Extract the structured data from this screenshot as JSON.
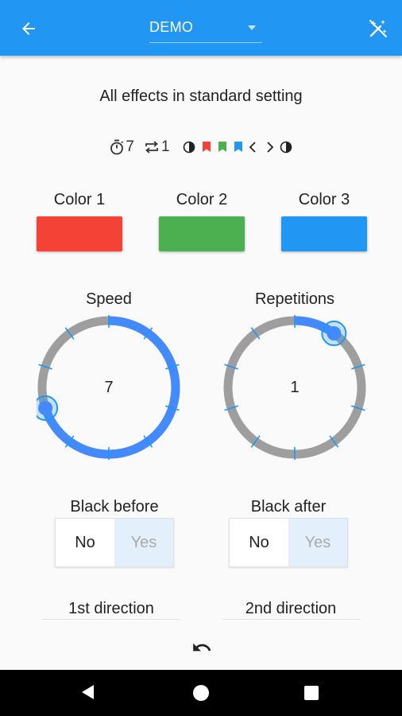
{
  "appbar": {
    "selected_effect": "DEMO",
    "background": "#2196f3"
  },
  "description": "All effects in standard setting",
  "summary": {
    "speed": "7",
    "repetitions": "1",
    "icons": [
      "timer-icon",
      "repeat-icon",
      "half-circle-icon",
      "flag-icon",
      "flag-icon",
      "flag-icon",
      "chevron-left-icon",
      "chevron-right-icon",
      "half-circle-icon"
    ],
    "flag_colors": [
      "#f44336",
      "#4caf50",
      "#2196f3"
    ]
  },
  "colors": [
    {
      "label": "Color 1",
      "value": "#f44336"
    },
    {
      "label": "Color 2",
      "value": "#4caf50"
    },
    {
      "label": "Color 3",
      "value": "#2196f3"
    }
  ],
  "speed": {
    "label": "Speed",
    "value": "7",
    "fraction": 0.7
  },
  "repetitions": {
    "label": "Repetitions",
    "value": "1",
    "fraction": 0.1
  },
  "dial_colors": {
    "active": "#448aff",
    "track": "#9e9e9e",
    "tick": "#2196f3"
  },
  "black_before": {
    "label": "Black before",
    "options": [
      "No",
      "Yes"
    ],
    "selected": "Yes"
  },
  "black_after": {
    "label": "Black after",
    "options": [
      "No",
      "Yes"
    ],
    "selected": "Yes"
  },
  "first_direction": {
    "label": "1st direction"
  },
  "second_direction": {
    "label": "2nd direction"
  }
}
